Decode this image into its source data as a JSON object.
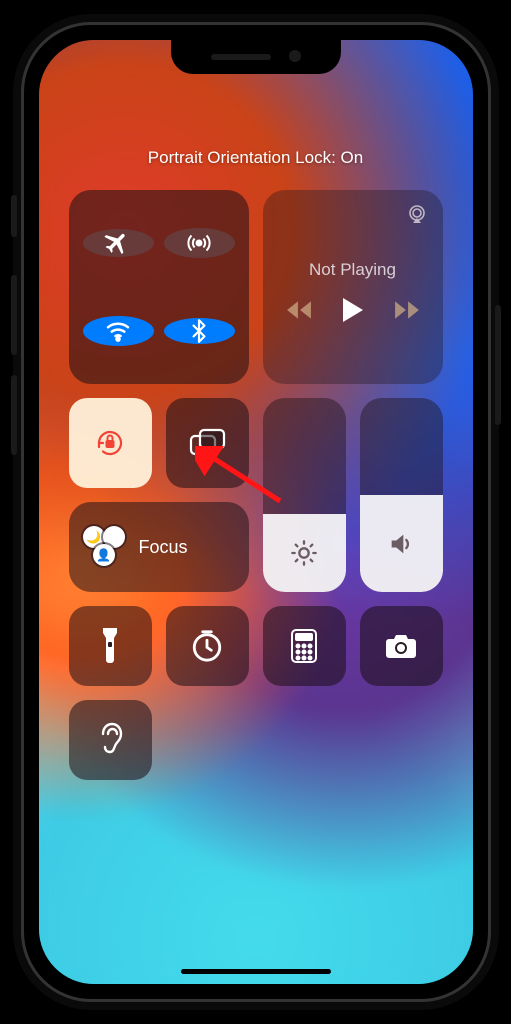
{
  "status_text": "Portrait Orientation Lock: On",
  "connectivity": {
    "airplane": {
      "on": false
    },
    "cellular": {
      "on": false
    },
    "wifi": {
      "on": true
    },
    "bluetooth": {
      "on": true
    }
  },
  "media": {
    "now_playing": "Not Playing"
  },
  "focus": {
    "label": "Focus"
  },
  "sliders": {
    "brightness_pct": 40,
    "volume_pct": 50
  },
  "annotation": {
    "target": "orientation-lock-button",
    "color": "#ff1a1a"
  }
}
